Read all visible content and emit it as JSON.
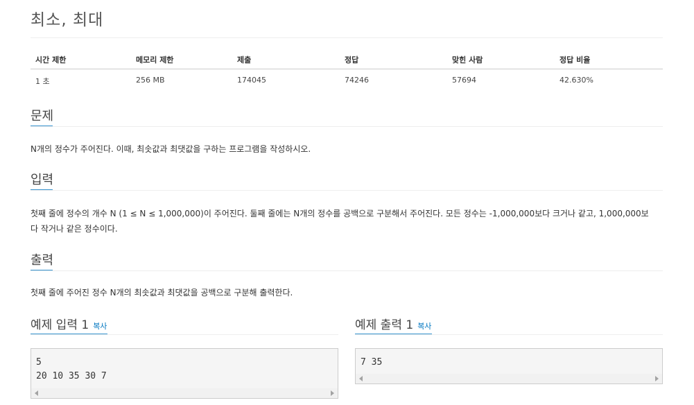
{
  "problem": {
    "title": "최소, 최대"
  },
  "stats": {
    "headers": [
      "시간 제한",
      "메모리 제한",
      "제출",
      "정답",
      "맞힌 사람",
      "정답 비율"
    ],
    "values": [
      "1 초",
      "256 MB",
      "174045",
      "74246",
      "57694",
      "42.630%"
    ]
  },
  "sections": {
    "problem": {
      "title": "문제",
      "body": "N개의 정수가 주어진다. 이때, 최솟값과 최댓값을 구하는 프로그램을 작성하시오."
    },
    "input": {
      "title": "입력",
      "body_line1": "첫째 줄에 정수의 개수 N (1 ≤ N ≤ 1,000,000)이 주어진다. 둘째 줄에는 N개의 정수를 공백으로 구분해서 주어진다. 모든 정수는 -1,000,000보다 크거나 같고, 1,000,000보",
      "body_line2": "다 작거나 같은 정수이다."
    },
    "output": {
      "title": "출력",
      "body": "첫째 줄에 주어진 정수 N개의 최솟값과 최댓값을 공백으로 구분해 출력한다."
    }
  },
  "examples": {
    "input": {
      "title": "예제 입력 1",
      "copy_label": "복사",
      "lines": [
        "5",
        "20 10 35 30 7"
      ]
    },
    "output": {
      "title": "예제 출력 1",
      "copy_label": "복사",
      "lines": [
        "7 35"
      ]
    }
  },
  "colors": {
    "accent": "#0076c0",
    "code_bg": "#f5f5f5"
  }
}
